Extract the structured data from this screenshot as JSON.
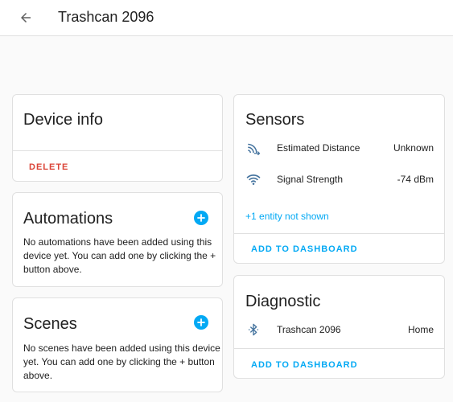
{
  "header": {
    "title": "Trashcan 2096"
  },
  "device_info": {
    "title": "Device info",
    "delete_label": "DELETE"
  },
  "automations": {
    "title": "Automations",
    "empty_text": "No automations have been added using this device yet. You can add one by clicking the + button above."
  },
  "scenes": {
    "title": "Scenes",
    "empty_text": "No scenes have been added using this device yet. You can add one by clicking the + button above."
  },
  "sensors": {
    "title": "Sensors",
    "rows": [
      {
        "name": "Estimated Distance",
        "value": "Unknown",
        "icon": "distance-icon"
      },
      {
        "name": "Signal Strength",
        "value": "-74 dBm",
        "icon": "wifi-icon"
      }
    ],
    "hidden_link": "+1 entity not shown",
    "add_label": "ADD TO DASHBOARD"
  },
  "diagnostic": {
    "title": "Diagnostic",
    "rows": [
      {
        "name": "Trashcan 2096",
        "value": "Home",
        "icon": "bluetooth-icon"
      }
    ],
    "add_label": "ADD TO DASHBOARD"
  },
  "colors": {
    "accent": "#03a9f4",
    "delete": "#db4437",
    "icon": "#44739e",
    "divider": "#e0e0e0",
    "background": "#fafafa"
  }
}
